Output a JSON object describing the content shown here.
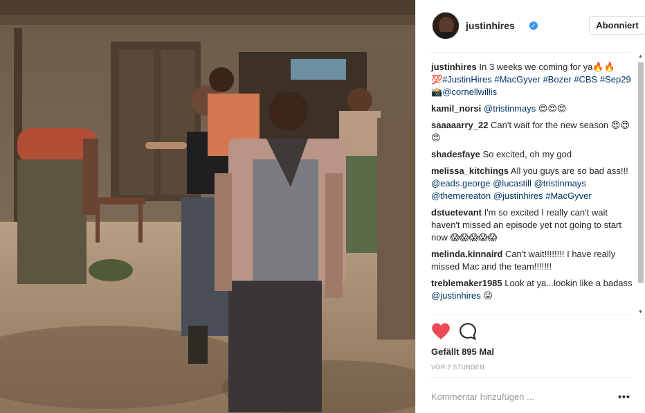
{
  "post": {
    "photo_alt": "photo",
    "colors": {
      "accent_link": "#003569",
      "like_red": "#ed4956",
      "verified_blue": "#3897f0"
    }
  },
  "header": {
    "username": "justinhires",
    "verified_icon": "verified-badge-icon",
    "follow_label": "Abonniert"
  },
  "comments": [
    {
      "user": "justinhires",
      "parts": [
        {
          "t": "text",
          "v": " In 3 weeks we coming for ya🔥🔥 💯"
        },
        {
          "t": "tag",
          "v": "#JustinHires"
        },
        {
          "t": "text",
          "v": " "
        },
        {
          "t": "tag",
          "v": "#MacGyver"
        },
        {
          "t": "text",
          "v": " "
        },
        {
          "t": "tag",
          "v": "#Bozer"
        },
        {
          "t": "text",
          "v": " "
        },
        {
          "t": "tag",
          "v": "#CBS"
        },
        {
          "t": "text",
          "v": " "
        },
        {
          "t": "tag",
          "v": "#Sep29"
        },
        {
          "t": "text",
          "v": " 📸"
        },
        {
          "t": "tag",
          "v": "@cornellwillis"
        }
      ]
    },
    {
      "user": "kamil_norsi",
      "parts": [
        {
          "t": "text",
          "v": " "
        },
        {
          "t": "tag",
          "v": "@tristinmays"
        },
        {
          "t": "text",
          "v": " 😍😍😍"
        }
      ]
    },
    {
      "user": "saaaaarry_22",
      "parts": [
        {
          "t": "text",
          "v": " Can't wait for the new season 😍😍😍"
        }
      ]
    },
    {
      "user": "shadesfaye",
      "parts": [
        {
          "t": "text",
          "v": " So excited, oh my god"
        }
      ]
    },
    {
      "user": "melissa_kitchings",
      "parts": [
        {
          "t": "text",
          "v": " All you guys are so bad ass!!! "
        },
        {
          "t": "tag",
          "v": "@eads.george"
        },
        {
          "t": "text",
          "v": " "
        },
        {
          "t": "tag",
          "v": "@lucastill"
        },
        {
          "t": "text",
          "v": " "
        },
        {
          "t": "tag",
          "v": "@tristinmays"
        },
        {
          "t": "text",
          "v": " "
        },
        {
          "t": "tag",
          "v": "@themereaton"
        },
        {
          "t": "text",
          "v": " "
        },
        {
          "t": "tag",
          "v": "@justinhires"
        },
        {
          "t": "text",
          "v": " "
        },
        {
          "t": "tag",
          "v": "#MacGyver"
        }
      ]
    },
    {
      "user": "dstuetevant",
      "parts": [
        {
          "t": "text",
          "v": " I'm so excited I really can't wait haven't missed an episode yet not going to start now 😱😱😱😱😱"
        }
      ]
    },
    {
      "user": "melinda.kinnaird",
      "parts": [
        {
          "t": "text",
          "v": " Can't wait!!!!!!!! I have really missed Mac and the team!!!!!!!"
        }
      ]
    },
    {
      "user": "treblemaker1985",
      "parts": [
        {
          "t": "text",
          "v": " Look at ya...lookin like a badass "
        },
        {
          "t": "tag",
          "v": "@justinhires"
        },
        {
          "t": "text",
          "v": " 😜"
        }
      ]
    }
  ],
  "actions": {
    "like_icon": "heart-filled-icon",
    "comment_icon": "comment-bubble-icon",
    "likes_text": "Gefällt 895 Mal",
    "timestamp": "VOR 2 STUNDEN"
  },
  "add_comment": {
    "placeholder": "Kommentar hinzufügen ...",
    "more_label": "•••"
  }
}
